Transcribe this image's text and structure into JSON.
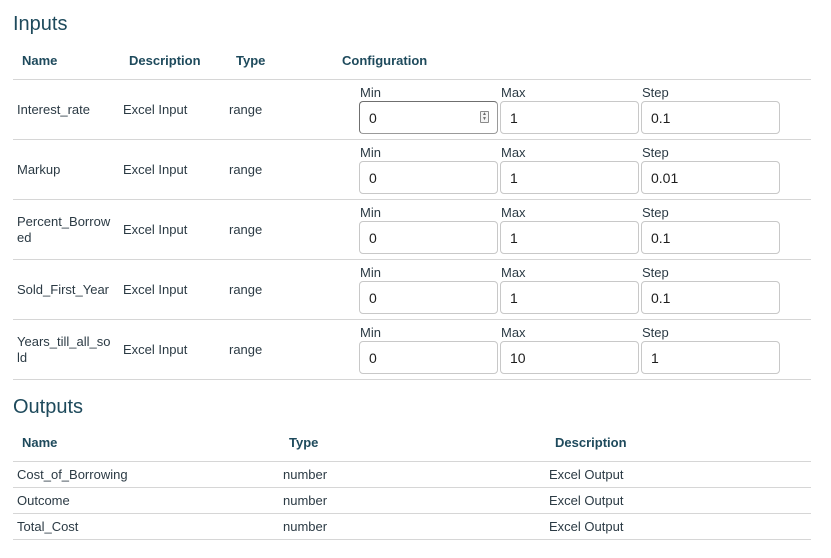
{
  "inputs": {
    "title": "Inputs",
    "headers": {
      "name": "Name",
      "description": "Description",
      "type": "Type",
      "configuration": "Configuration"
    },
    "config_labels": {
      "min": "Min",
      "max": "Max",
      "step": "Step"
    },
    "rows": [
      {
        "name": "Interest_rate",
        "description": "Excel Input",
        "type": "range",
        "min": "0",
        "max": "1",
        "step": "0.1"
      },
      {
        "name": "Markup",
        "description": "Excel Input",
        "type": "range",
        "min": "0",
        "max": "1",
        "step": "0.01"
      },
      {
        "name_line1": "Percent_Borrow",
        "name_line2": "ed",
        "description": "Excel Input",
        "type": "range",
        "min": "0",
        "max": "1",
        "step": "0.1"
      },
      {
        "name": "Sold_First_Year",
        "description": "Excel Input",
        "type": "range",
        "min": "0",
        "max": "1",
        "step": "0.1"
      },
      {
        "name_line1": "Years_till_all_so",
        "name_line2": "ld",
        "description": "Excel Input",
        "type": "range",
        "min": "0",
        "max": "10",
        "step": "1"
      }
    ]
  },
  "outputs": {
    "title": "Outputs",
    "headers": {
      "name": "Name",
      "type": "Type",
      "description": "Description"
    },
    "rows": [
      {
        "name": "Cost_of_Borrowing",
        "type": "number",
        "description": "Excel Output"
      },
      {
        "name": "Outcome",
        "type": "number",
        "description": "Excel Output"
      },
      {
        "name": "Total_Cost",
        "type": "number",
        "description": "Excel Output"
      }
    ]
  },
  "icons": {
    "spinner": "spinner-icon"
  }
}
